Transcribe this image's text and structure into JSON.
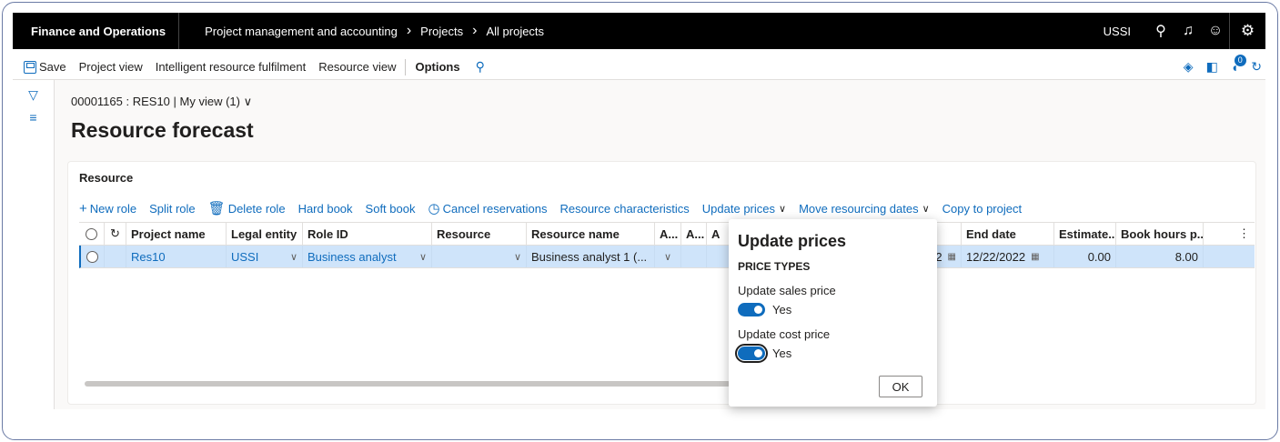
{
  "topbar": {
    "brand": "Finance and Operations",
    "breadcrumbs": [
      "Project management and accounting",
      "Projects",
      "All projects"
    ],
    "company": "USSI",
    "icons": [
      "search-icon",
      "bell-icon",
      "smiley-icon",
      "gear-icon"
    ]
  },
  "actionbar": {
    "save": "Save",
    "items": [
      "Project view",
      "Intelligent resource fulfilment",
      "Resource view"
    ],
    "options": "Options",
    "notification_count": "0"
  },
  "page": {
    "path": "00001165 : RES10",
    "view": "My view (1)",
    "title": "Resource forecast"
  },
  "panel": {
    "title": "Resource",
    "actions": {
      "new_role": "New role",
      "split_role": "Split role",
      "delete_role": "Delete role",
      "hard_book": "Hard book",
      "soft_book": "Soft book",
      "cancel_reservations": "Cancel reservations",
      "resource_characteristics": "Resource characteristics",
      "update_prices": "Update prices",
      "move_resourcing_dates": "Move resourcing dates",
      "copy_to_project": "Copy to project"
    }
  },
  "grid": {
    "columns": {
      "project_name": "Project name",
      "legal_entity": "Legal entity",
      "role_id": "Role ID",
      "resource": "Resource",
      "resource_name": "Resource name",
      "a1": "A...",
      "a2": "A...",
      "a3": "A",
      "end_date": "End date",
      "estimated": "Estimate...",
      "book_hours": "Book hours p..."
    },
    "row": {
      "project_name": "Res10",
      "legal_entity": "USSI",
      "role_id": "Business analyst",
      "resource": "",
      "resource_name": "Business analyst 1 (...",
      "start_date_fragment": "2",
      "end_date": "12/22/2022",
      "estimated": "0.00",
      "book_hours": "8.00"
    }
  },
  "popup": {
    "title": "Update prices",
    "section": "PRICE TYPES",
    "sales_label": "Update sales price",
    "sales_value": "Yes",
    "cost_label": "Update cost price",
    "cost_value": "Yes",
    "ok": "OK"
  },
  "colors": {
    "accent": "#0f6cbd",
    "selected_row": "#cfe4fa",
    "topbar": "#000000"
  }
}
